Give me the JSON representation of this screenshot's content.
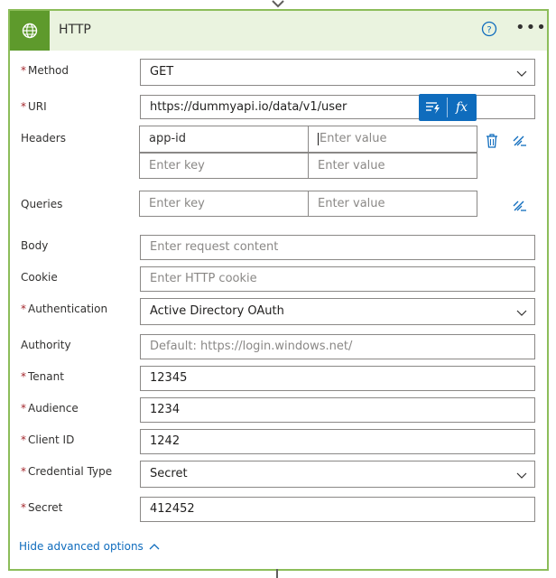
{
  "header": {
    "title": "HTTP"
  },
  "fields": {
    "method": {
      "label": "Method",
      "required": true,
      "value": "GET"
    },
    "uri": {
      "label": "URI",
      "required": true,
      "value": "https://dummyapi.io/data/v1/user"
    },
    "headers": {
      "label": "Headers",
      "rows": [
        {
          "key": "app-id",
          "value_placeholder": "Enter value"
        },
        {
          "key_placeholder": "Enter key",
          "value_placeholder": "Enter value"
        }
      ]
    },
    "queries": {
      "label": "Queries",
      "key_placeholder": "Enter key",
      "value_placeholder": "Enter value"
    },
    "body": {
      "label": "Body",
      "placeholder": "Enter request content"
    },
    "cookie": {
      "label": "Cookie",
      "placeholder": "Enter HTTP cookie"
    },
    "authentication": {
      "label": "Authentication",
      "required": true,
      "value": "Active Directory OAuth"
    },
    "authority": {
      "label": "Authority",
      "placeholder": "Default: https://login.windows.net/"
    },
    "tenant": {
      "label": "Tenant",
      "required": true,
      "value": "12345"
    },
    "audience": {
      "label": "Audience",
      "required": true,
      "value": "1234"
    },
    "client_id": {
      "label": "Client ID",
      "required": true,
      "value": "1242"
    },
    "credential_type": {
      "label": "Credential Type",
      "required": true,
      "value": "Secret"
    },
    "secret": {
      "label": "Secret",
      "required": true,
      "value": "412452"
    }
  },
  "dynamic_content": {
    "fx_label": "fx"
  },
  "footer": {
    "hide_advanced_label": "Hide advanced options"
  },
  "colors": {
    "accent": "#0f6cbd",
    "header_bg": "#eaf3df",
    "icon_bg": "#5e9a2c",
    "border": "#8cbd5a",
    "required": "#a4262c"
  }
}
